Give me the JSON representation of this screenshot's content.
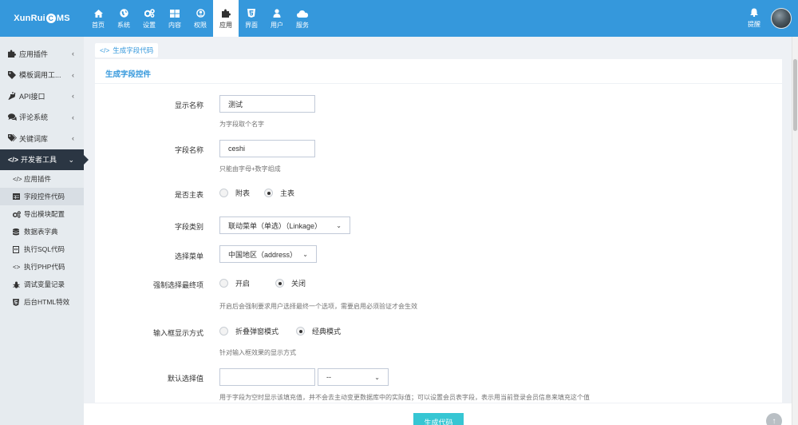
{
  "app": {
    "logo_left": "XunRui",
    "logo_c": "C",
    "logo_right": "MS"
  },
  "nav": {
    "items": [
      {
        "label": "首页",
        "icon": "home-icon"
      },
      {
        "label": "系统",
        "icon": "globe-icon"
      },
      {
        "label": "设置",
        "icon": "gears-icon"
      },
      {
        "label": "内容",
        "icon": "grid-icon"
      },
      {
        "label": "权限",
        "icon": "user-circle-icon"
      },
      {
        "label": "应用",
        "icon": "puzzle-icon"
      },
      {
        "label": "界面",
        "icon": "html5-icon"
      },
      {
        "label": "用户",
        "icon": "user-icon"
      },
      {
        "label": "服务",
        "icon": "cloud-icon"
      }
    ],
    "active": "应用",
    "remind_label": "提醒"
  },
  "sidebar": {
    "items": [
      {
        "label": "应用插件",
        "icon": "puzzle-icon"
      },
      {
        "label": "模板调用工...",
        "icon": "tag-icon"
      },
      {
        "label": "API接口",
        "icon": "plug-icon"
      },
      {
        "label": "评论系统",
        "icon": "comments-icon"
      },
      {
        "label": "关键词库",
        "icon": "tags-icon"
      },
      {
        "label": "开发者工具",
        "icon": "code-icon"
      }
    ],
    "subitems": [
      {
        "label": "应用插件",
        "icon": "code-icon"
      },
      {
        "label": "字段控件代码",
        "icon": "table-icon"
      },
      {
        "label": "导出模块配置",
        "icon": "cogs-icon"
      },
      {
        "label": "数据表字典",
        "icon": "database-icon"
      },
      {
        "label": "执行SQL代码",
        "icon": "file-code-icon"
      },
      {
        "label": "执行PHP代码",
        "icon": "code-icon"
      },
      {
        "label": "调试变量记录",
        "icon": "bug-icon"
      },
      {
        "label": "后台HTML特效",
        "icon": "html5-icon"
      }
    ]
  },
  "breadcrumb": {
    "icon": "code-icon",
    "label": "生成字段代码"
  },
  "panel": {
    "title": "生成字段控件"
  },
  "form": {
    "display_name": {
      "label": "显示名称",
      "value": "测试",
      "help": "为字段取个名字"
    },
    "field_name": {
      "label": "字段名称",
      "value": "ceshi",
      "help": "只能由字母+数字组成"
    },
    "main_table": {
      "label": "是否主表",
      "options": [
        "附表",
        "主表"
      ],
      "selected": "主表"
    },
    "field_type": {
      "label": "字段类别",
      "value": "联动菜单（单选）（Linkage）"
    },
    "select_menu": {
      "label": "选择菜单",
      "value": "中国地区（address）"
    },
    "force_last": {
      "label": "强制选择最终项",
      "options": [
        "开启",
        "关闭"
      ],
      "selected": "关闭",
      "help": "开启后会强制要求用户选择最终一个选项，需要启用必须验证才会生效"
    },
    "input_display": {
      "label": "输入框显示方式",
      "options": [
        "折叠弹窗模式",
        "经典模式"
      ],
      "selected": "经典模式",
      "help": "针对输入框效果的显示方式"
    },
    "default_value": {
      "label": "默认选择值",
      "value": "",
      "select_value": "--",
      "help": "用于字段为空时显示该填充值，并不会去主动变更数据库中的实际值；可以设置会员表字段，表示用当前登录会员信息来填充这个值"
    }
  },
  "footer": {
    "generate_button": "生成代码"
  },
  "colors": {
    "brand": "#3598dc",
    "sidebar_dark": "#2b3643",
    "button": "#36c6d3"
  }
}
